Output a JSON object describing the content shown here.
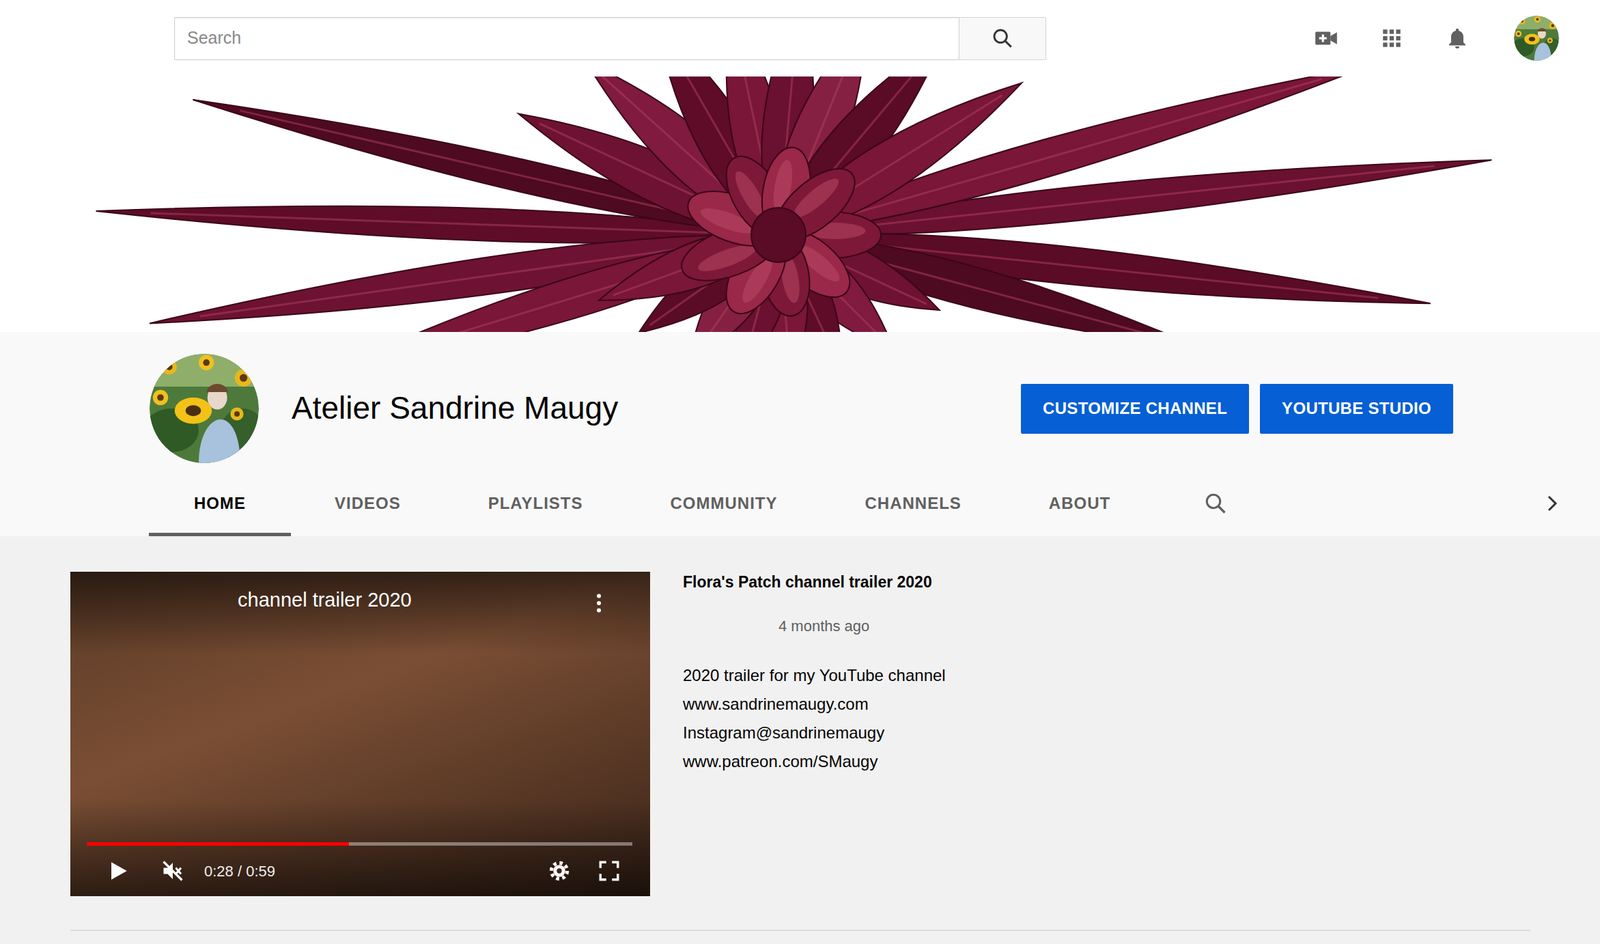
{
  "search": {
    "placeholder": "Search"
  },
  "channel": {
    "name": "Atelier Sandrine Maugy"
  },
  "buttons": [
    {
      "label": "CUSTOMIZE CHANNEL"
    },
    {
      "label": "YOUTUBE STUDIO"
    }
  ],
  "tabs": [
    {
      "label": "HOME",
      "selected": true
    },
    {
      "label": "VIDEOS",
      "selected": false
    },
    {
      "label": "PLAYLISTS",
      "selected": false
    },
    {
      "label": "COMMUNITY",
      "selected": false
    },
    {
      "label": "CHANNELS",
      "selected": false
    },
    {
      "label": "ABOUT",
      "selected": false
    }
  ],
  "featured": {
    "player": {
      "title": "channel trailer 2020",
      "time": "0:28 / 0:59",
      "level": 0.48,
      "muted": true
    },
    "title": "Flora's Patch channel trailer 2020",
    "age": "4 months ago",
    "description": [
      "2020 trailer for my YouTube channel",
      "www.sandrinemaugy.com",
      "Instagram@sandrinemaugy",
      "www.patreon.com/SMaugy"
    ]
  }
}
